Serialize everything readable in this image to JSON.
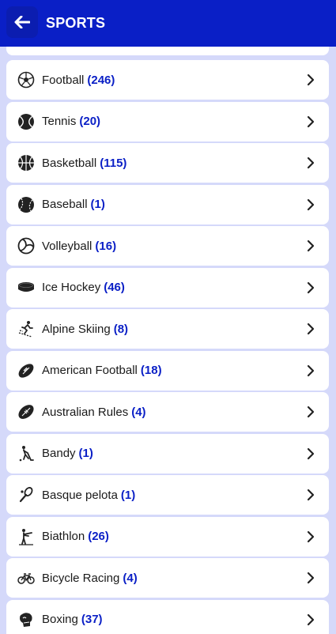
{
  "header": {
    "title": "SPORTS"
  },
  "sports": [
    {
      "name": "Football",
      "count": "(246)",
      "icon": "soccer-ball-icon"
    },
    {
      "name": "Tennis",
      "count": "(20)",
      "icon": "tennis-ball-icon"
    },
    {
      "name": "Basketball",
      "count": "(115)",
      "icon": "basketball-icon"
    },
    {
      "name": "Baseball",
      "count": "(1)",
      "icon": "baseball-icon"
    },
    {
      "name": "Volleyball",
      "count": "(16)",
      "icon": "volleyball-icon"
    },
    {
      "name": "Ice Hockey",
      "count": "(46)",
      "icon": "hockey-puck-icon"
    },
    {
      "name": "Alpine Skiing",
      "count": "(8)",
      "icon": "skier-icon"
    },
    {
      "name": "American Football",
      "count": "(18)",
      "icon": "american-football-icon"
    },
    {
      "name": "Australian Rules",
      "count": "(4)",
      "icon": "aussie-rules-ball-icon"
    },
    {
      "name": "Bandy",
      "count": "(1)",
      "icon": "bandy-player-icon"
    },
    {
      "name": "Basque pelota",
      "count": "(1)",
      "icon": "pelota-racket-icon"
    },
    {
      "name": "Biathlon",
      "count": "(26)",
      "icon": "biathlon-shooter-icon"
    },
    {
      "name": "Bicycle Racing",
      "count": "(4)",
      "icon": "bicycle-icon"
    },
    {
      "name": "Boxing",
      "count": "(37)",
      "icon": "boxing-glove-icon"
    }
  ]
}
